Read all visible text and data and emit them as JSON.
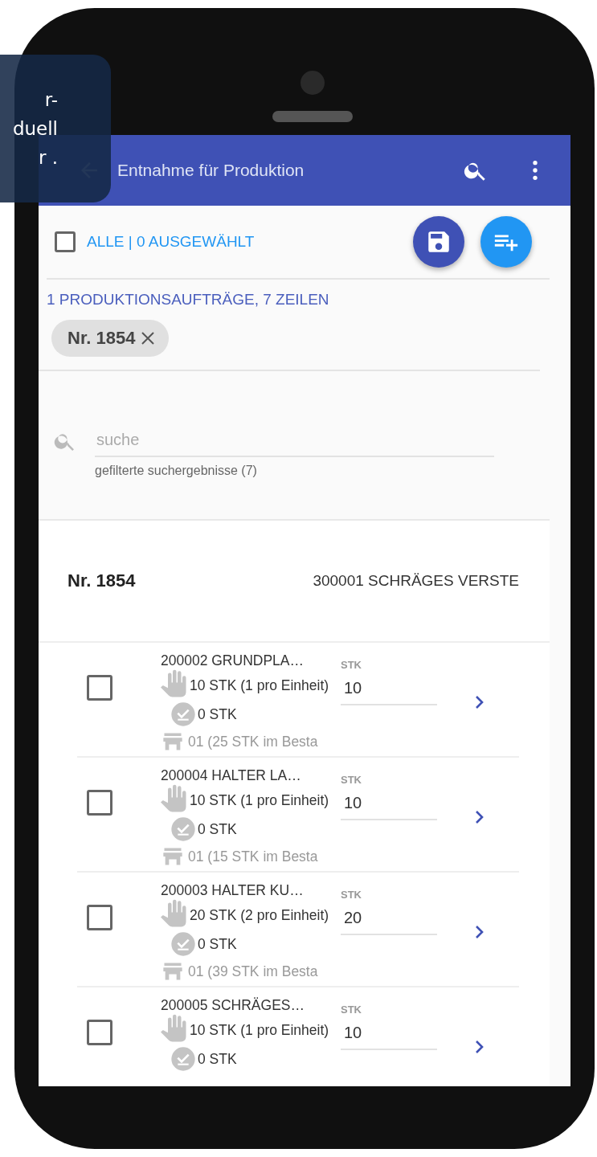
{
  "tooltip": {
    "lines": [
      "r-",
      "duell",
      "r ."
    ]
  },
  "app_bar": {
    "title": "Entnahme für Produktion"
  },
  "selection": {
    "checked": false,
    "label": "ALLE | 0 AUSGEWÄHLT"
  },
  "summary": "1 PRODUKTIONSAUFTRÄGE, 7 ZEILEN",
  "filter_chips": [
    {
      "label": "Nr. 1854"
    }
  ],
  "search": {
    "placeholder": "suche",
    "helper": "gefilterte suchergebnisse (7)"
  },
  "order": {
    "number": "Nr. 1854",
    "article": "300001 SCHRÄGES VERSTE"
  },
  "items": [
    {
      "checked": false,
      "name": "200002 GRUNDPLA…",
      "required": "10 STK (1 pro Einheit)",
      "taken": "0 STK",
      "stock": "01 (25 STK im Besta",
      "qty_label": "STK",
      "qty": "10"
    },
    {
      "checked": false,
      "name": "200004 HALTER LA…",
      "required": "10 STK (1 pro Einheit)",
      "taken": "0 STK",
      "stock": "01 (15 STK im Besta",
      "qty_label": "STK",
      "qty": "10"
    },
    {
      "checked": false,
      "name": "200003 HALTER KU…",
      "required": "20 STK (2 pro Einheit)",
      "taken": "0 STK",
      "stock": "01 (39 STK im Besta",
      "qty_label": "STK",
      "qty": "20"
    },
    {
      "checked": false,
      "name": "200005 SCHRÄGES…",
      "required": "10 STK (1 pro Einheit)",
      "taken": "0 STK",
      "qty_label": "STK",
      "qty": "10"
    }
  ]
}
